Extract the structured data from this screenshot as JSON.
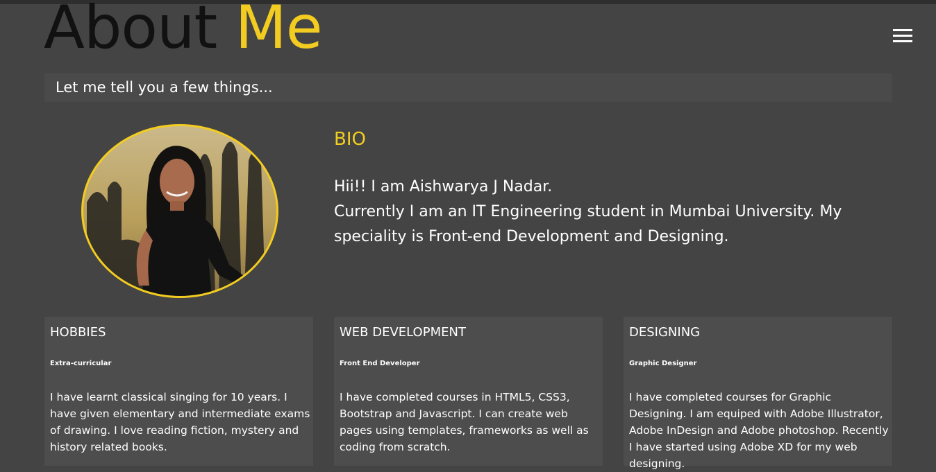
{
  "header": {
    "title_part1": "About",
    "title_part2": "Me",
    "menu_icon": "hamburger-menu-icon"
  },
  "subtitle": "Let me tell you a few things...",
  "bio": {
    "heading": "BIO",
    "line1": "Hii!! I am Aishwarya J Nadar.",
    "line2": "Currently I am an IT Engineering student in Mumbai University. My speciality is Front-end Development and Designing."
  },
  "cards": [
    {
      "title": "HOBBIES",
      "subtitle": "Extra-curricular",
      "body": "I have learnt classical singing for 10 years. I have given elementary and intermediate exams of drawing. I love reading fiction, mystery and history related books."
    },
    {
      "title": "WEB DEVELOPMENT",
      "subtitle": "Front End Developer",
      "body": "I have completed courses in HTML5, CSS3, Bootstrap and Javascript. I can create web pages using templates, frameworks as well as coding from scratch."
    },
    {
      "title": "DESIGNING",
      "subtitle": "Graphic Designer",
      "body": "I have completed courses for Graphic Designing. I am equiped with Adobe Illustrator, Adobe InDesign and Adobe photoshop. Recently I have started using Adobe XD for my web designing."
    }
  ],
  "colors": {
    "background": "#444444",
    "accent": "#f2cc20",
    "card_background": "#4d4d4d"
  }
}
